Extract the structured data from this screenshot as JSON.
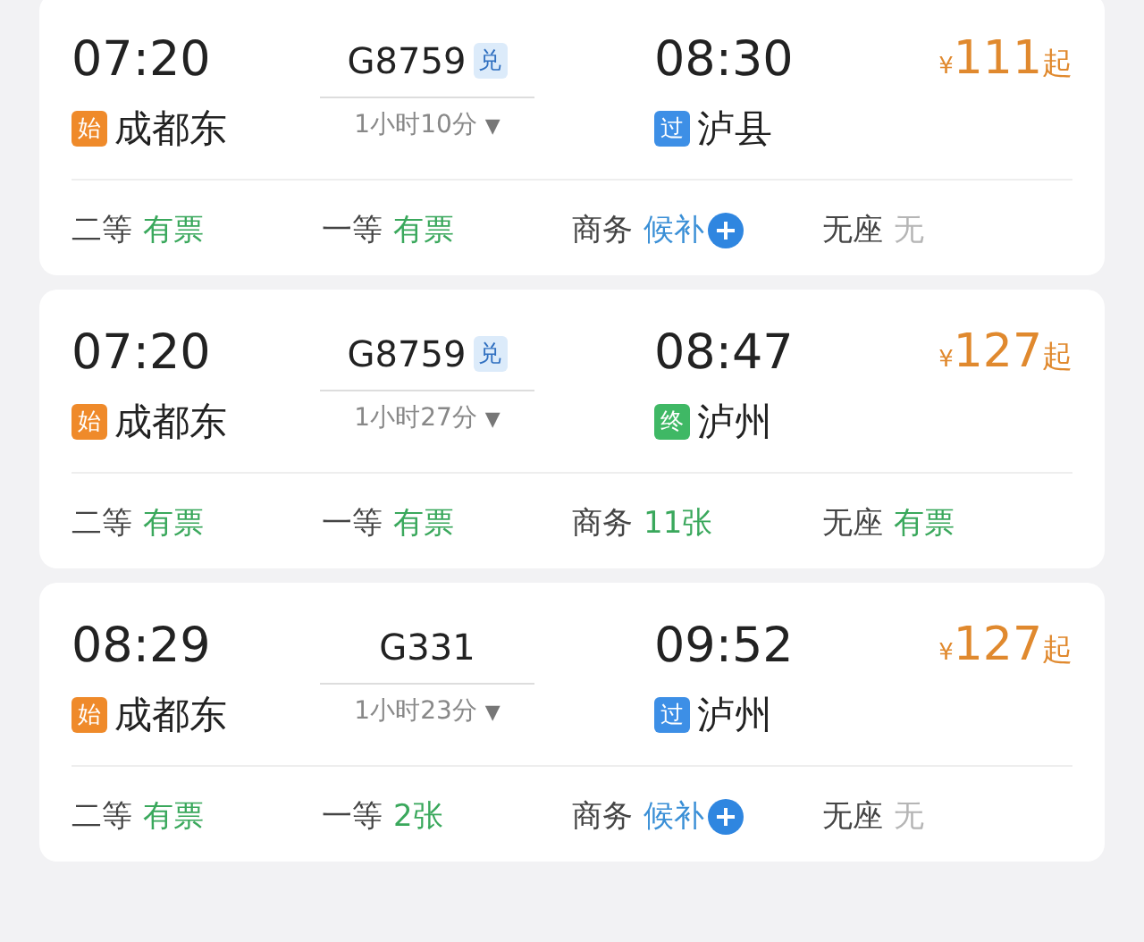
{
  "trains": [
    {
      "depart_time": "07:20",
      "depart_station": {
        "badge": "始",
        "kind": "start",
        "name": "成都东"
      },
      "train_no": "G8759",
      "redeem_badge": "兑",
      "duration": "1小时10分",
      "duration_caret": "▼",
      "arrive_time": "08:30",
      "arrive_station": {
        "badge": "过",
        "kind": "pass",
        "name": "泸县"
      },
      "price": {
        "currency": "¥",
        "amount": "111",
        "suffix": "起"
      },
      "seats": [
        {
          "class": "二等",
          "status": "有票",
          "kind": "available"
        },
        {
          "class": "一等",
          "status": "有票",
          "kind": "available"
        },
        {
          "class": "商务",
          "status": "候补",
          "kind": "waitlist"
        },
        {
          "class": "无座",
          "status": "无",
          "kind": "none"
        }
      ]
    },
    {
      "depart_time": "07:20",
      "depart_station": {
        "badge": "始",
        "kind": "start",
        "name": "成都东"
      },
      "train_no": "G8759",
      "redeem_badge": "兑",
      "duration": "1小时27分",
      "duration_caret": "▼",
      "arrive_time": "08:47",
      "arrive_station": {
        "badge": "终",
        "kind": "end",
        "name": "泸州"
      },
      "price": {
        "currency": "¥",
        "amount": "127",
        "suffix": "起"
      },
      "seats": [
        {
          "class": "二等",
          "status": "有票",
          "kind": "available"
        },
        {
          "class": "一等",
          "status": "有票",
          "kind": "available"
        },
        {
          "class": "商务",
          "status": "11张",
          "kind": "available"
        },
        {
          "class": "无座",
          "status": "有票",
          "kind": "available"
        }
      ]
    },
    {
      "depart_time": "08:29",
      "depart_station": {
        "badge": "始",
        "kind": "start",
        "name": "成都东"
      },
      "train_no": "G331",
      "duration": "1小时23分",
      "duration_caret": "▼",
      "arrive_time": "09:52",
      "arrive_station": {
        "badge": "过",
        "kind": "pass",
        "name": "泸州"
      },
      "price": {
        "currency": "¥",
        "amount": "127",
        "suffix": "起"
      },
      "seats": [
        {
          "class": "二等",
          "status": "有票",
          "kind": "available"
        },
        {
          "class": "一等",
          "status": "2张",
          "kind": "available"
        },
        {
          "class": "商务",
          "status": "候补",
          "kind": "waitlist"
        },
        {
          "class": "无座",
          "status": "无",
          "kind": "none"
        }
      ]
    }
  ]
}
